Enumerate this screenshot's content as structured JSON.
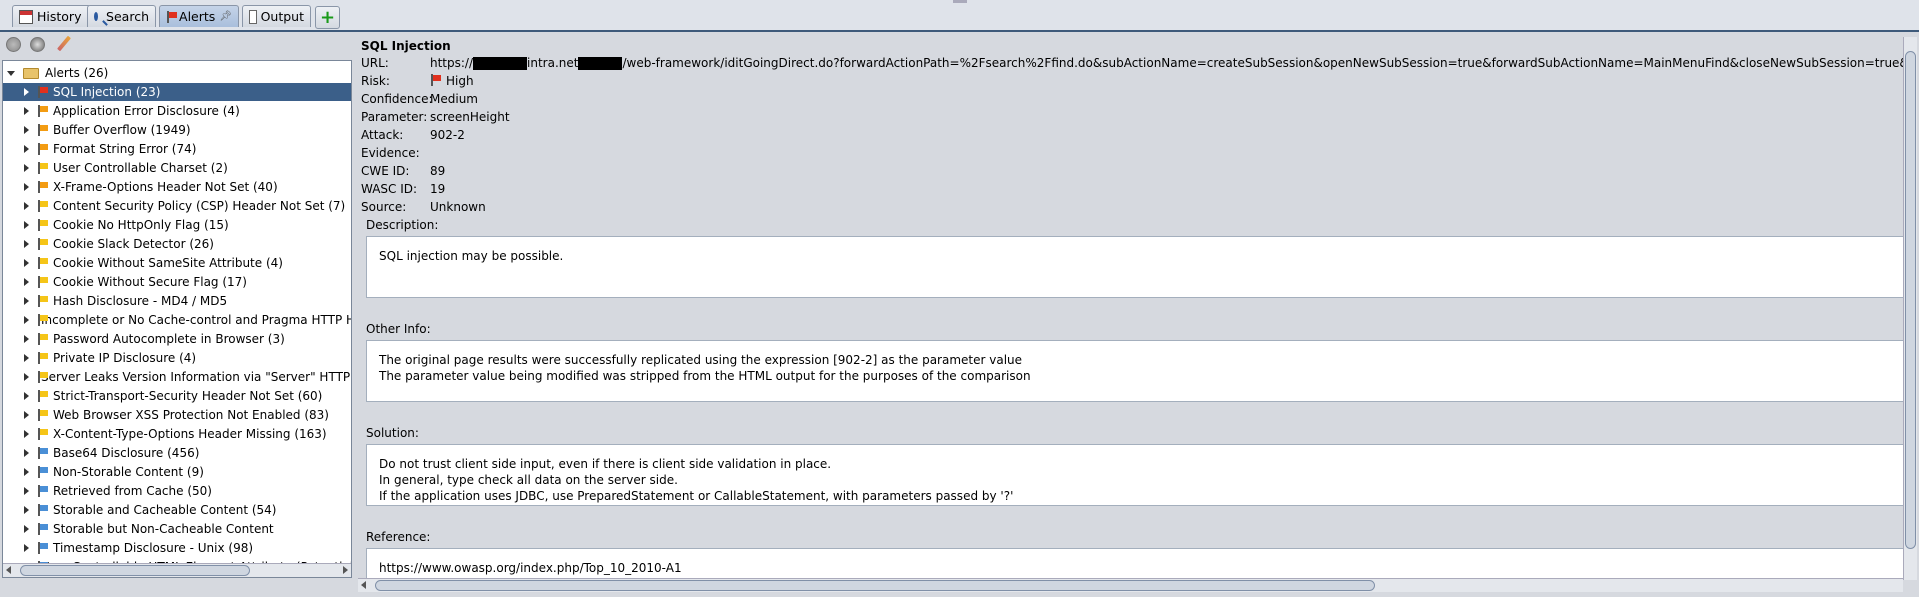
{
  "tabs": [
    {
      "label": "History",
      "icon": "calendar-icon"
    },
    {
      "label": "Search",
      "icon": "search-icon"
    },
    {
      "label": "Alerts",
      "icon": "flag-icon"
    },
    {
      "label": "Output",
      "icon": "document-icon"
    }
  ],
  "tree": {
    "root": "Alerts (26)",
    "items": [
      {
        "label": "SQL Injection (23)",
        "risk": "high"
      },
      {
        "label": "Application Error Disclosure (4)",
        "risk": "medium"
      },
      {
        "label": "Buffer Overflow (1949)",
        "risk": "medium"
      },
      {
        "label": "Format String Error (74)",
        "risk": "medium"
      },
      {
        "label": "User Controllable Charset (2)",
        "risk": "low"
      },
      {
        "label": "X-Frame-Options Header Not Set (40)",
        "risk": "medium"
      },
      {
        "label": "Content Security Policy (CSP) Header Not Set (7)",
        "risk": "low"
      },
      {
        "label": "Cookie No HttpOnly Flag (15)",
        "risk": "low"
      },
      {
        "label": "Cookie Slack Detector (26)",
        "risk": "low"
      },
      {
        "label": "Cookie Without SameSite Attribute (4)",
        "risk": "low"
      },
      {
        "label": "Cookie Without Secure Flag (17)",
        "risk": "low"
      },
      {
        "label": "Hash Disclosure - MD4 / MD5",
        "risk": "low"
      },
      {
        "label": "Incomplete or No Cache-control and Pragma HTTP Hea",
        "risk": "low"
      },
      {
        "label": "Password Autocomplete in Browser (3)",
        "risk": "low"
      },
      {
        "label": "Private IP Disclosure (4)",
        "risk": "low"
      },
      {
        "label": "Server Leaks Version Information via \"Server\" HTTP Re",
        "risk": "low"
      },
      {
        "label": "Strict-Transport-Security Header Not Set (60)",
        "risk": "low"
      },
      {
        "label": "Web Browser XSS Protection Not Enabled (83)",
        "risk": "low"
      },
      {
        "label": "X-Content-Type-Options Header Missing (163)",
        "risk": "low"
      },
      {
        "label": "Base64 Disclosure (456)",
        "risk": "info"
      },
      {
        "label": "Non-Storable Content (9)",
        "risk": "info"
      },
      {
        "label": "Retrieved from Cache (50)",
        "risk": "info"
      },
      {
        "label": "Storable and Cacheable Content (54)",
        "risk": "info"
      },
      {
        "label": "Storable but Non-Cacheable Content",
        "risk": "info"
      },
      {
        "label": "Timestamp Disclosure - Unix (98)",
        "risk": "info"
      },
      {
        "label": "User Controllable HTML Element Attribute (Potential XS",
        "risk": "info"
      }
    ]
  },
  "detail": {
    "title": "SQL Injection",
    "url_label": "URL:",
    "url_prefix": "https://",
    "url_mid": "intra.net",
    "url_suffix": "/web-framework/iditGoingDirect.do?forwardActionPath=%2Fsearch%2Ffind.do&subActionName=createSubSession&openNewSubSession=true&forwardSubActionName=MainMenuFind&closeNewSubSession=true&com.idit.web.subSe",
    "risk_label": "Risk:",
    "risk": "High",
    "confidence_label": "Confidence:",
    "confidence": "Medium",
    "parameter_label": "Parameter:",
    "parameter": "screenHeight",
    "attack_label": "Attack:",
    "attack": "902-2",
    "evidence_label": "Evidence:",
    "evidence": "",
    "cwe_label": "CWE ID:",
    "cwe": "89",
    "wasc_label": "WASC ID:",
    "wasc": "19",
    "source_label": "Source:",
    "source": "Unknown",
    "description_label": "Description:",
    "description": "SQL injection may be possible.",
    "other_label": "Other Info:",
    "other_lines": [
      "The original page results were successfully replicated using the expression [902-2] as the parameter value",
      "The parameter value being modified was stripped from the HTML output for the purposes of the comparison"
    ],
    "solution_label": "Solution:",
    "solution_lines": [
      "Do not trust client side input, even if there is client side validation in place.",
      "In general, type check all data on the server side.",
      "If the application uses JDBC, use PreparedStatement or CallableStatement, with parameters passed by '?'"
    ],
    "reference_label": "Reference:",
    "reference": "https://www.owasp.org/index.php/Top_10_2010-A1"
  },
  "colors": {
    "high": "#e0301e",
    "medium": "#f39c12",
    "low": "#f5c518",
    "info": "#4a8fd6",
    "selected": "#3b5f89"
  }
}
